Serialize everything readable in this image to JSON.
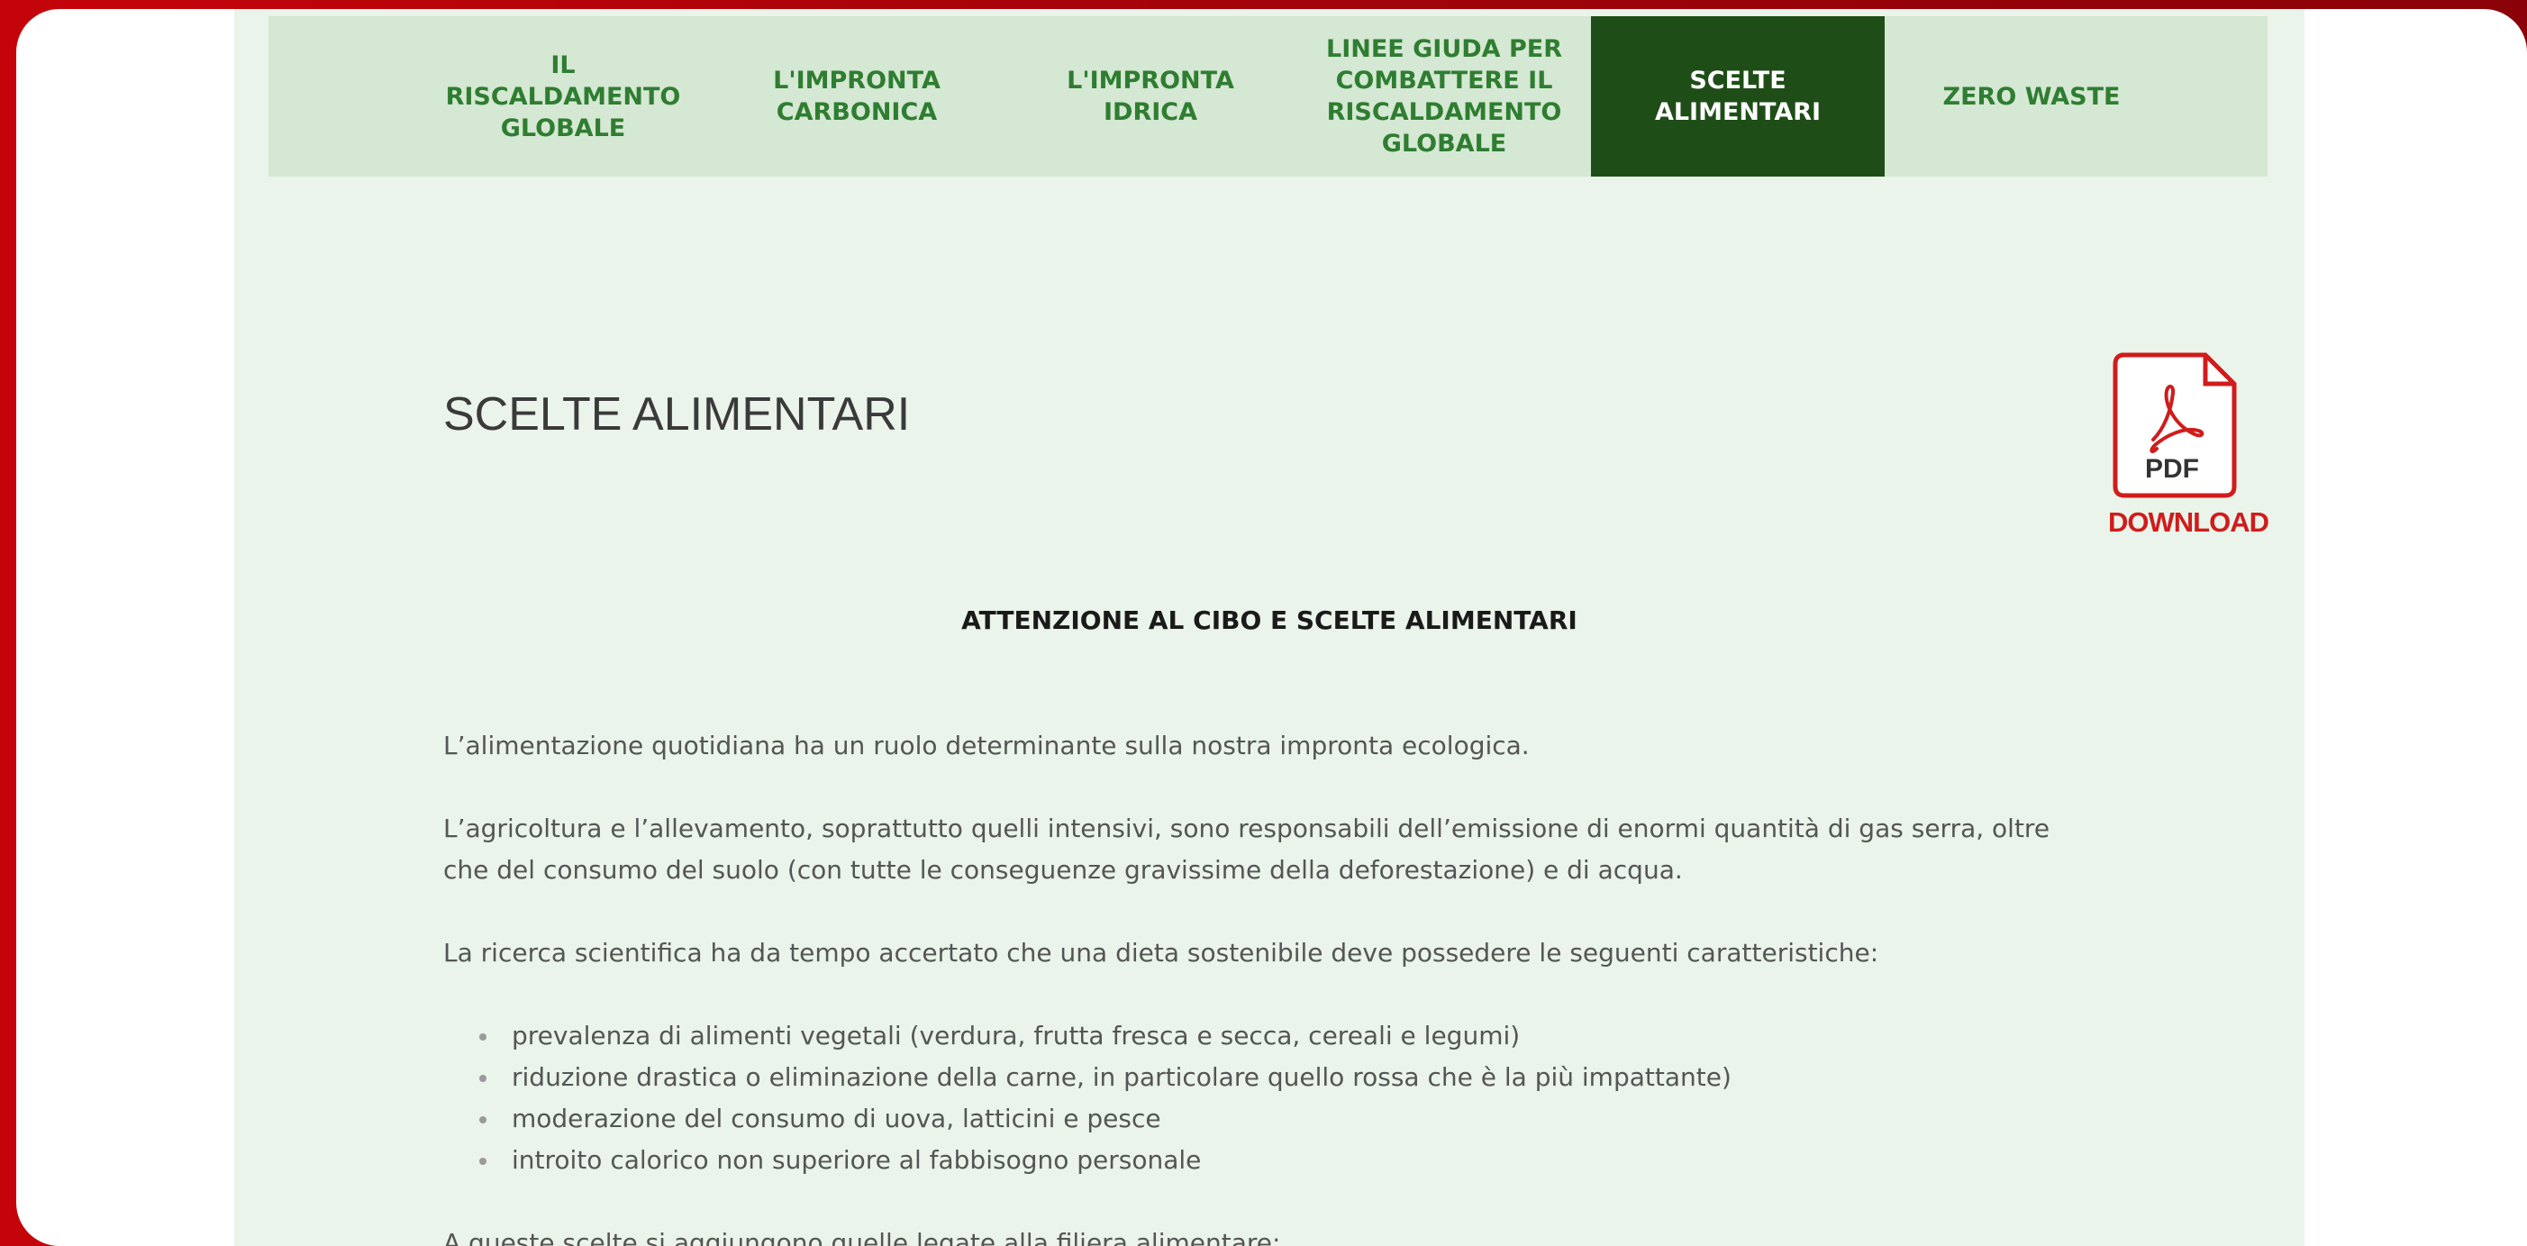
{
  "nav": {
    "items": [
      {
        "label": "IL RISCALDAMENTO GLOBALE",
        "active": false
      },
      {
        "label": "L'IMPRONTA CARBONICA",
        "active": false
      },
      {
        "label": "L'IMPRONTA IDRICA",
        "active": false
      },
      {
        "label": "LINEE GIUDA PER COMBATTERE IL RISCALDAMENTO GLOBALE",
        "active": false
      },
      {
        "label": "SCELTE ALIMENTARI",
        "active": true
      },
      {
        "label": "ZERO WASTE",
        "active": false
      }
    ]
  },
  "page": {
    "title": "SCELTE ALIMENTARI",
    "subheading": "ATTENZIONE AL CIBO E SCELTE ALIMENTARI"
  },
  "pdf": {
    "icon": "pdf-icon",
    "text": "PDF",
    "label": "DOWNLOAD"
  },
  "content": {
    "paragraphs": [
      "L’alimentazione quotidiana ha un ruolo determinante sulla nostra impronta ecologica.",
      "L’agricoltura e l’allevamento, soprattutto quelli intensivi, sono responsabili dell’emissione di enormi quantità di gas serra, oltre che del consumo del suolo (con tutte le conseguenze gravissime della deforestazione) e di acqua.",
      "La ricerca scientifica ha da tempo accertato che una dieta sostenibile deve possedere le seguenti caratteristiche:"
    ],
    "list": [
      "prevalenza di alimenti vegetali (verdura, frutta fresca e secca, cereali e legumi)",
      "riduzione drastica o eliminazione della carne, in particolare quello rossa che è la più impattante)",
      "moderazione del consumo di uova, latticini e pesce",
      "introito calorico non superiore al fabbisogno personale"
    ],
    "trailing": "A queste scelte si aggiungono quelle legate alla filiera alimentare:"
  },
  "colors": {
    "nav_bg": "#d4e8d3",
    "nav_text": "#2f7d31",
    "nav_active_bg": "#1f4d17",
    "page_bg": "#eaf4ea",
    "pdf_red": "#d01c1c",
    "outer_red": "#c4040a"
  }
}
